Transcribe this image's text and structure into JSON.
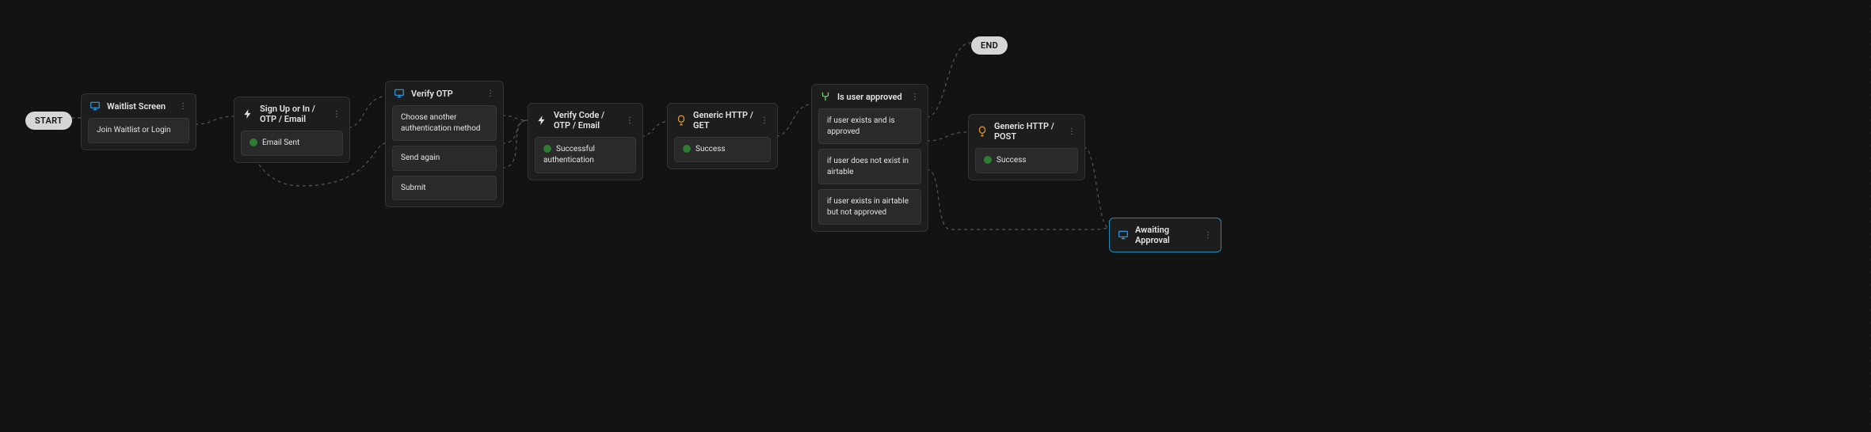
{
  "terminals": {
    "start": "START",
    "end": "END"
  },
  "nodes": [
    {
      "id": "waitlist",
      "type": "screen",
      "title": "Waitlist Screen",
      "outlets": [
        {
          "label": "Join Waitlist or Login"
        }
      ]
    },
    {
      "id": "signup",
      "type": "action",
      "title": "Sign Up or In / OTP / Email",
      "outlets": [
        {
          "label": "Email Sent",
          "status": "ok"
        }
      ]
    },
    {
      "id": "verifyotp",
      "type": "screen",
      "title": "Verify OTP",
      "outlets": [
        {
          "label": "Choose another authentication method"
        },
        {
          "label": "Send again"
        },
        {
          "label": "Submit"
        }
      ]
    },
    {
      "id": "verifycode",
      "type": "action",
      "title": "Verify Code / OTP / Email",
      "outlets": [
        {
          "label": "Successful authentication",
          "status": "ok"
        }
      ]
    },
    {
      "id": "httpget",
      "type": "http",
      "title": "Generic HTTP / GET",
      "outlets": [
        {
          "label": "Success",
          "status": "ok"
        }
      ]
    },
    {
      "id": "branch",
      "type": "branch",
      "title": "Is user approved",
      "outlets": [
        {
          "label": "if user exists and is approved"
        },
        {
          "label": "if user does not exist in airtable"
        },
        {
          "label": "if user exists in airtable but not approved"
        }
      ]
    },
    {
      "id": "httppost",
      "type": "http",
      "title": "Generic HTTP / POST",
      "outlets": [
        {
          "label": "Success",
          "status": "ok"
        }
      ]
    },
    {
      "id": "awaiting",
      "type": "screen",
      "title": "Awaiting Approval",
      "selected": true,
      "outlets": []
    }
  ],
  "icons": {
    "screen": "monitor-icon",
    "action": "bolt-icon",
    "http": "http-icon",
    "branch": "fork-icon",
    "more": "more-vert-icon"
  },
  "colors": {
    "screen": "#2aa4f4",
    "action": "#e0e0e0",
    "http": "#f0a030",
    "branch": "#6fe86f"
  }
}
